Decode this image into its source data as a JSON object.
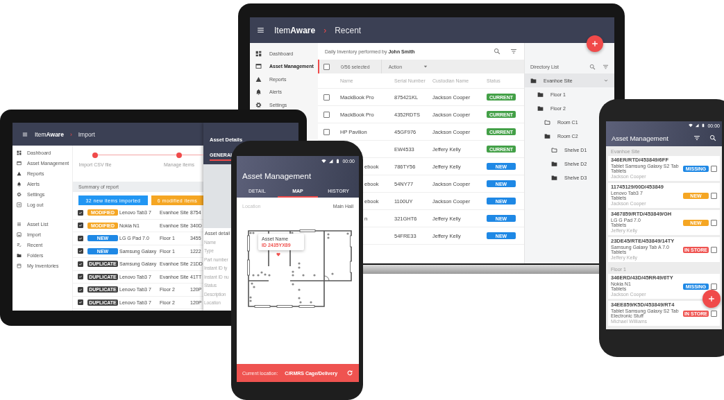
{
  "laptop": {
    "app_name": "Item**Aware**",
    "separator": "›",
    "page_title": "Recent",
    "sidebar": [
      {
        "kind": "dashboard",
        "label": "Dashboard",
        "selected": false
      },
      {
        "kind": "asset",
        "label": "Asset Management",
        "selected": true
      },
      {
        "kind": "reports",
        "label": "Reports",
        "selected": false
      },
      {
        "kind": "alerts",
        "label": "Alerts",
        "selected": false
      },
      {
        "kind": "settings",
        "label": "Settings",
        "selected": false
      }
    ],
    "heading": "Daily Inventory performed by **John Smith**",
    "select_all_checked": false,
    "selection": "0/56 selected",
    "action": "Action",
    "columns": [
      "Name",
      "Serial Number",
      "Custodian Name",
      "Status"
    ],
    "rows": [
      {
        "checked": false,
        "name": "MackBook Pro",
        "serial": "875421KL",
        "custodian": "Jackson Cooper",
        "status": "CURRENT",
        "color": "#43a047"
      },
      {
        "checked": false,
        "name": "MackBook Pro",
        "serial": "4352RDTS",
        "custodian": "Jackson Cooper",
        "status": "CURRENT",
        "color": "#43a047"
      },
      {
        "checked": false,
        "name": "HP Pavilion",
        "serial": "45GF976",
        "custodian": "Jackson Cooper",
        "status": "CURRENT",
        "color": "#43a047"
      },
      {
        "serial": "EW4533",
        "custodian": "Jeffery Kelly",
        "status": "CURRENT",
        "color": "#43a047"
      },
      {
        "name_tail": "ebook",
        "serial": "786TY56",
        "custodian": "Jeffery Kelly",
        "status": "NEW",
        "color": "#1e88e5"
      },
      {
        "name_tail": "ebook",
        "serial": "54NY77",
        "custodian": "Jackson Cooper",
        "status": "NEW",
        "color": "#1e88e5"
      },
      {
        "name_tail": "ebook",
        "serial": "1100UY",
        "custodian": "Jackson Cooper",
        "status": "NEW",
        "color": "#1e88e5"
      },
      {
        "name_tail": "n",
        "serial": "321GHT6",
        "custodian": "Jeffery Kelly",
        "status": "NEW",
        "color": "#1e88e5"
      },
      {
        "serial": "54FRE33",
        "custodian": "Jeffery Kelly",
        "status": "NEW",
        "color": "#1e88e5"
      }
    ],
    "directory": {
      "title": "Directory List",
      "tree": [
        {
          "label": "Evanhoe Site",
          "kind": "folder",
          "selected": true,
          "children": [
            {
              "label": "Floor 1",
              "kind": "folder",
              "selected": false
            },
            {
              "label": "Floor 2",
              "kind": "folder",
              "selected": false,
              "children": [
                {
                  "label": "Room C1",
                  "kind": "outline",
                  "selected": false
                },
                {
                  "label": "Room C2",
                  "kind": "folder",
                  "selected": false,
                  "children": [
                    {
                      "label": "Shelve D1",
                      "kind": "outline",
                      "selected": false
                    },
                    {
                      "label": "Shelve D2",
                      "kind": "folder",
                      "selected": false
                    },
                    {
                      "label": "Shelve D3",
                      "kind": "folder",
                      "selected": false
                    }
                  ]
                }
              ]
            }
          ]
        }
      ]
    }
  },
  "tablet": {
    "app_name": "Item**Aware**",
    "separator": "›",
    "page_title": "Import",
    "sidebar_groups": [
      [
        {
          "kind": "dashboard",
          "label": "Dashboard"
        },
        {
          "kind": "asset",
          "label": "Asset Management"
        },
        {
          "kind": "reports",
          "label": "Reports"
        },
        {
          "kind": "alerts",
          "label": "Alerts"
        },
        {
          "kind": "settings",
          "label": "Settings"
        },
        {
          "kind": "logout",
          "label": "Log out"
        }
      ],
      [
        {
          "kind": "list",
          "label": "Asset List"
        },
        {
          "kind": "import",
          "label": "Import"
        },
        {
          "kind": "recent",
          "label": "Recent"
        },
        {
          "kind": "folder",
          "label": "Folders"
        },
        {
          "kind": "inventories",
          "label": "My Inventories"
        }
      ]
    ],
    "steps": [
      "Import CSV file",
      "Manage items"
    ],
    "summary_title": "Summary of report",
    "summary_bars": [
      {
        "label": "32 new items imported",
        "color": "#2196f3"
      },
      {
        "label": "6 modified items",
        "color": "#f5a623"
      }
    ],
    "rows": [
      {
        "checked": true,
        "status": "MODIFIED",
        "color": "#f5a623",
        "name": "Lenovo Tab3 7",
        "site": "Evanhoe Site",
        "serial": "8754"
      },
      {
        "checked": true,
        "status": "MODIFIED",
        "color": "#f5a623",
        "name": "Nokia N1",
        "site": "Evanhoe Site",
        "serial": "340D"
      },
      {
        "checked": true,
        "status": "NEW",
        "color": "#1e88e5",
        "name": "LG G Pad 7.0",
        "site": "Floor 1",
        "serial": "3455"
      },
      {
        "checked": true,
        "status": "NEW",
        "color": "#1e88e5",
        "name": "Samsung Galaxy",
        "site": "Floor 1",
        "serial": "1222"
      },
      {
        "checked": true,
        "status": "DUPLICATE",
        "color": "#424242",
        "name": "Samsung Galaxy",
        "site": "Evanhoe Site",
        "serial": "21DD"
      },
      {
        "checked": true,
        "status": "DUPLICATE",
        "color": "#424242",
        "name": "Lenovo Tab3 7",
        "site": "Evanhoe Site",
        "serial": "41TT"
      },
      {
        "checked": true,
        "status": "DUPLICATE",
        "color": "#424242",
        "name": "Lenovo Tab3 7",
        "site": "Floor 2",
        "serial": "120P"
      },
      {
        "checked": true,
        "status": "DUPLICATE",
        "color": "#424242",
        "name": "Lenovo Tab3 7",
        "site": "Floor 2",
        "serial": "120P"
      }
    ],
    "details": {
      "title": "Asset Details",
      "tabs": [
        {
          "label": "GENERAL",
          "selected": true
        }
      ],
      "section": "Asset detail",
      "fields": [
        "Name",
        "Type",
        "Part number",
        "Instant ID ty",
        "Instant ID nu",
        "Status",
        "Description",
        "Location"
      ]
    }
  },
  "map_phone": {
    "time": "00:00",
    "title": "Asset Management",
    "tabs": [
      {
        "label": "DETAIL",
        "selected": false
      },
      {
        "label": "MAP",
        "selected": true
      },
      {
        "label": "HISTORY",
        "selected": false
      }
    ],
    "location_label": "Location",
    "location_value": "Main Hall",
    "tooltip": {
      "title": "Asset Name",
      "id": "ID 2435YX89"
    },
    "current_label": "Current location:",
    "current_value": "C/RMRS Cage/Delivery"
  },
  "list_phone": {
    "time": "00:00",
    "title": "Asset Management",
    "groups": [
      {
        "title": "Evanhoe Site",
        "items": [
          {
            "code": "346ER/RTD/453849/6FF",
            "model": "Tablet Samsung Galaxy S2 Tab",
            "category": "Tablets",
            "custodian": "Jackson Cooper",
            "status": "MISSING",
            "color": "#1e88e5",
            "checked": false
          },
          {
            "code": "11745129/00D/453849",
            "model": "Lenovo Tab3 7",
            "category": "Tablets",
            "custodian": "Jackson Cooper",
            "status": "NEW",
            "color": "#f5a623",
            "checked": false
          },
          {
            "code": "3467859/RTD/453849/GH",
            "model": "LG G Pad 7.0",
            "category": "Tablets",
            "custodian": "Jeffery Kelly",
            "status": "NEW",
            "color": "#f5a623",
            "checked": false
          },
          {
            "code": "23DE45/RTE/453849/14TY",
            "model": "Samsung Galaxy Tab A 7.0",
            "category": "Tablets",
            "custodian": "Jeffery Kelly",
            "status": "IN STORE",
            "color": "#ef5350",
            "checked": false
          }
        ]
      },
      {
        "title": "Floor 1",
        "items": [
          {
            "code": "346ERD/43D/45RR49/6TY",
            "model": "Nokia N1",
            "category": "Tablets",
            "custodian": "Jackson Cooper",
            "status": "MISSING",
            "color": "#1e88e5",
            "checked": false
          },
          {
            "code": "34EE859/K5D/453849/RT4",
            "model": "Tablet Samsung Galaxy S2 Tab",
            "category": "Electronic Stuff",
            "custodian": "Michael Williams",
            "status": "IN STORE",
            "color": "#ef5350",
            "checked": false
          }
        ]
      }
    ]
  }
}
